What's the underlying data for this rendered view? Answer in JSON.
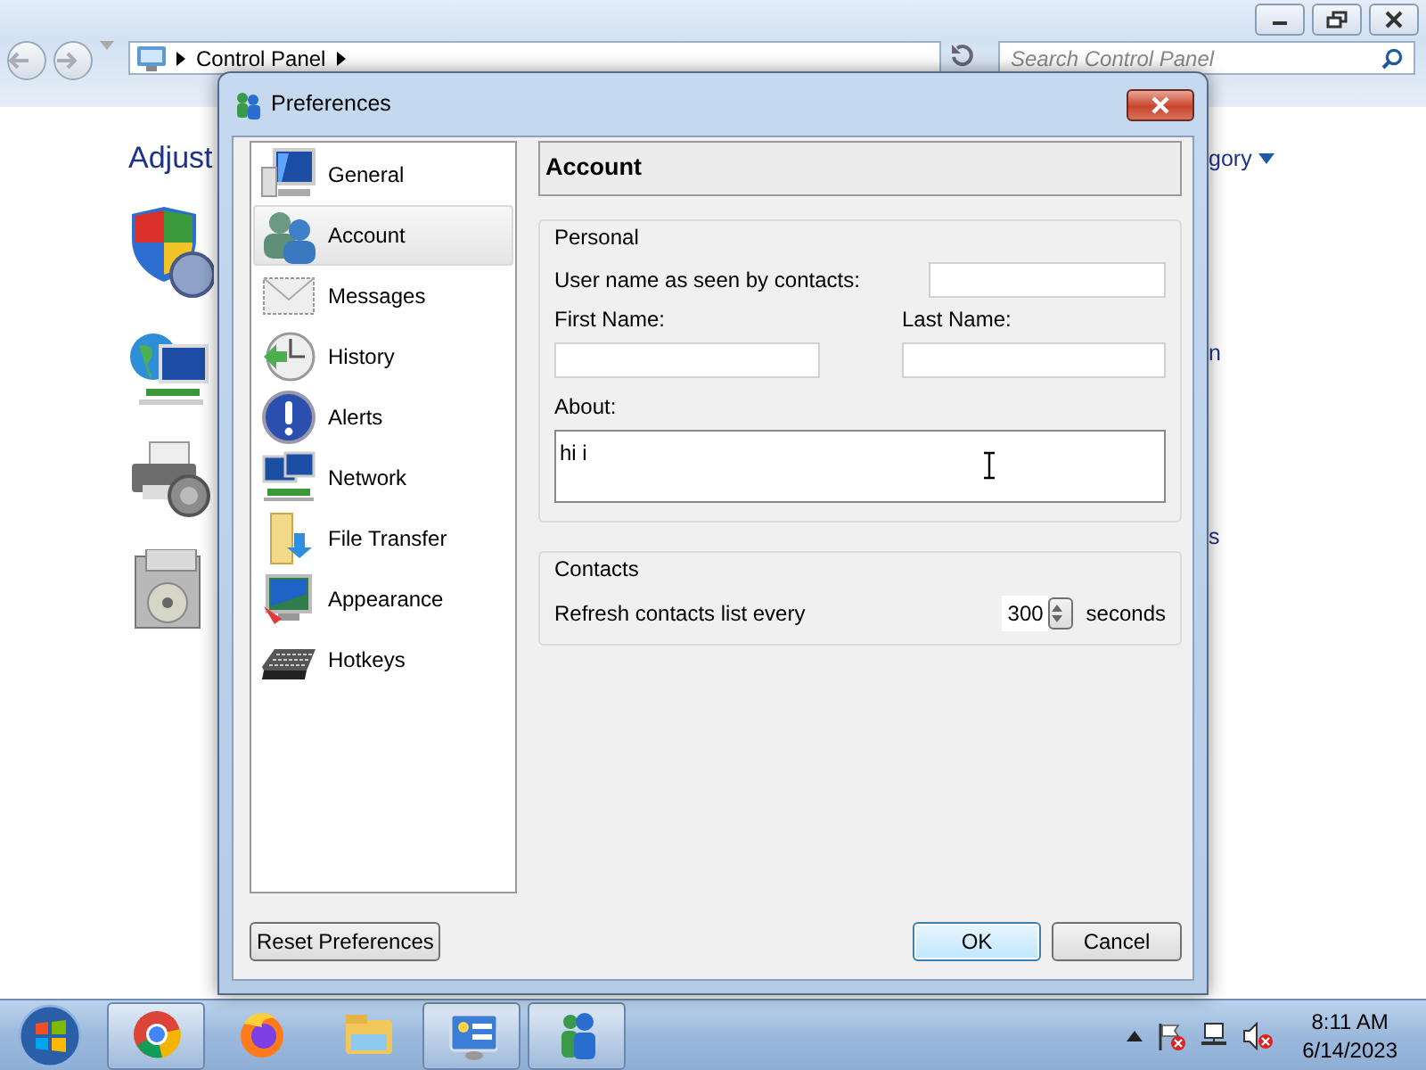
{
  "background_window": {
    "address_path": "Control Panel",
    "search_placeholder": "Search Control Panel",
    "heading": "Adjust",
    "view_by": "gory",
    "text_fragments": [
      "n",
      "s"
    ]
  },
  "dialog": {
    "title": "Preferences",
    "categories": [
      {
        "label": "General",
        "selected": false
      },
      {
        "label": "Account",
        "selected": true
      },
      {
        "label": "Messages",
        "selected": false
      },
      {
        "label": "History",
        "selected": false
      },
      {
        "label": "Alerts",
        "selected": false
      },
      {
        "label": "Network",
        "selected": false
      },
      {
        "label": "File Transfer",
        "selected": false
      },
      {
        "label": "Appearance",
        "selected": false
      },
      {
        "label": "Hotkeys",
        "selected": false
      }
    ],
    "page_title": "Account",
    "personal": {
      "title": "Personal",
      "username_label": "User name as seen by contacts:",
      "first_name_label": "First Name:",
      "last_name_label": "Last Name:",
      "about_label": "About:",
      "about_value": "hi i"
    },
    "contacts": {
      "title": "Contacts",
      "refresh_label": "Refresh contacts list every",
      "refresh_value": "300",
      "refresh_unit": "seconds"
    },
    "buttons": {
      "reset": "Reset Preferences",
      "ok": "OK",
      "cancel": "Cancel"
    }
  },
  "taskbar": {
    "apps": [
      {
        "running": true
      },
      {
        "running": false
      },
      {
        "running": false
      },
      {
        "running": true
      },
      {
        "running": true
      }
    ],
    "clock": {
      "time": "8:11 AM",
      "date": "6/14/2023"
    }
  }
}
